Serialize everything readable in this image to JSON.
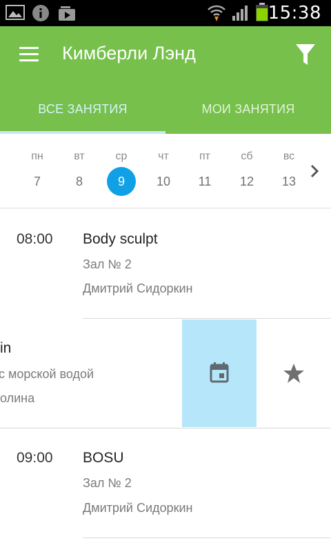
{
  "status_bar": {
    "time": "15:38",
    "icons": [
      "gallery-icon",
      "info-icon",
      "media-icon",
      "wifi-icon",
      "signal-icon",
      "battery-icon"
    ]
  },
  "app_bar": {
    "title": "Кимберли Лэнд",
    "background": "#76c04b",
    "tabs": [
      {
        "label": "ВСЕ ЗАНЯТИЯ",
        "active": true
      },
      {
        "label": "МОИ ЗАНЯТИЯ",
        "active": false
      }
    ]
  },
  "week": {
    "days": [
      {
        "name": "пн",
        "num": "7"
      },
      {
        "name": "вт",
        "num": "8"
      },
      {
        "name": "ср",
        "num": "9",
        "selected": true
      },
      {
        "name": "чт",
        "num": "10"
      },
      {
        "name": "пт",
        "num": "11"
      },
      {
        "name": "сб",
        "num": "12"
      },
      {
        "name": "вс",
        "num": "13"
      }
    ],
    "selected_color": "#0fa0e6"
  },
  "sessions": [
    {
      "time": "08:00",
      "title": "Body sculpt",
      "room": "Зал № 2",
      "trainer": "Дмитрий Сидоркин"
    },
    {
      "title_fragment": "in",
      "room_fragment": "морской водой",
      "trainer_fragment": "олина"
    },
    {
      "time": "09:00",
      "title": "BOSU",
      "room": "Зал № 2",
      "trainer": "Дмитрий Сидоркин"
    }
  ]
}
